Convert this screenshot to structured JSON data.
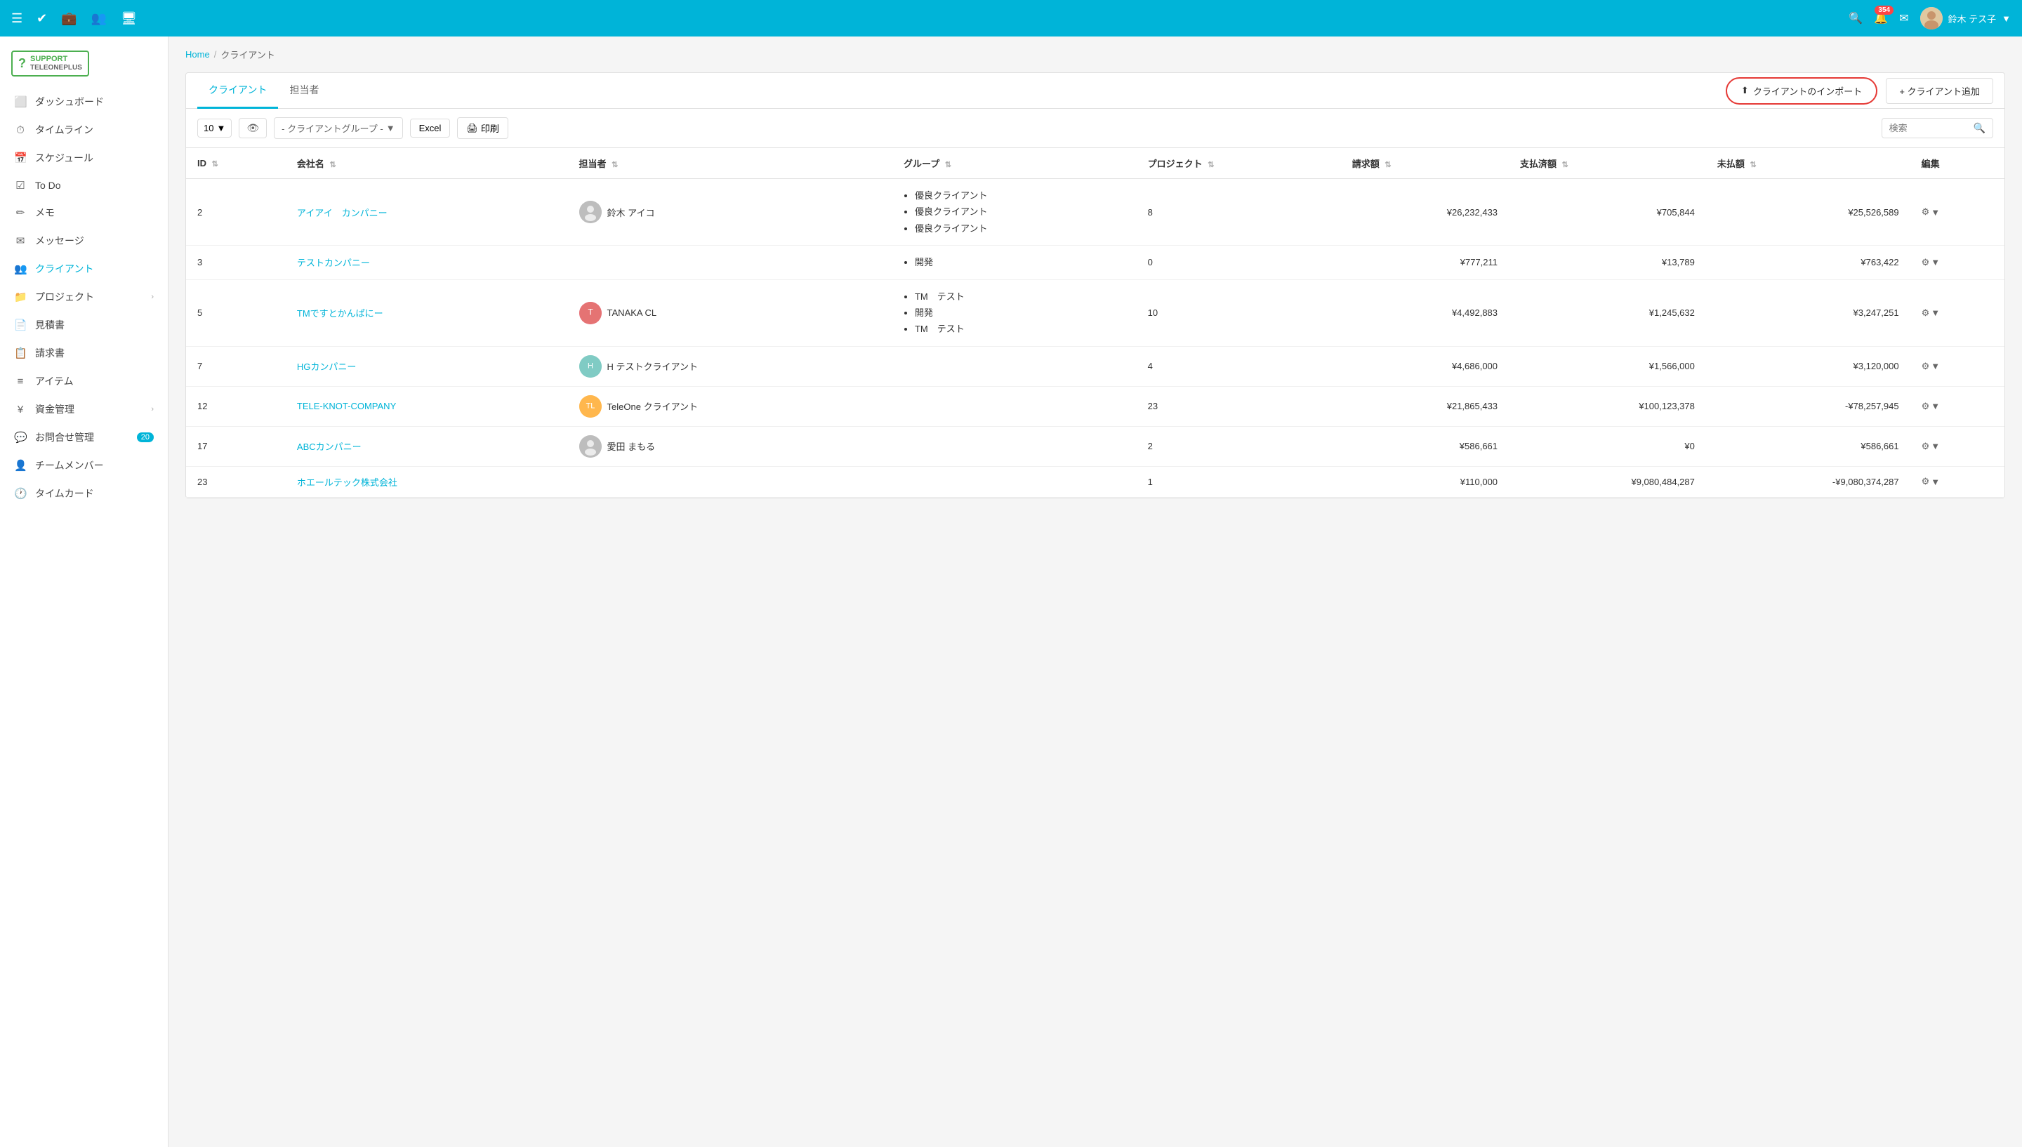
{
  "logo": {
    "icon": "?",
    "line1": "SUPPORT",
    "line2": "TELEONEPLUS"
  },
  "topnav": {
    "notification_count": "354",
    "username": "鈴木 テス子"
  },
  "sidebar": {
    "items": [
      {
        "id": "dashboard",
        "label": "ダッシュボード",
        "icon": "🖥",
        "has_arrow": false,
        "badge": null
      },
      {
        "id": "timeline",
        "label": "タイムライン",
        "icon": "⏱",
        "has_arrow": false,
        "badge": null
      },
      {
        "id": "schedule",
        "label": "スケジュール",
        "icon": "📅",
        "has_arrow": false,
        "badge": null
      },
      {
        "id": "todo",
        "label": "To Do",
        "icon": "✅",
        "has_arrow": false,
        "badge": null
      },
      {
        "id": "memo",
        "label": "メモ",
        "icon": "✏",
        "has_arrow": false,
        "badge": null
      },
      {
        "id": "message",
        "label": "メッセージ",
        "icon": "✉",
        "has_arrow": false,
        "badge": null
      },
      {
        "id": "client",
        "label": "クライアント",
        "icon": "👥",
        "has_arrow": false,
        "badge": null,
        "active": true
      },
      {
        "id": "project",
        "label": "プロジェクト",
        "icon": "📁",
        "has_arrow": true,
        "badge": null
      },
      {
        "id": "estimate",
        "label": "見積書",
        "icon": "📄",
        "has_arrow": false,
        "badge": null
      },
      {
        "id": "invoice",
        "label": "請求書",
        "icon": "📋",
        "has_arrow": false,
        "badge": null
      },
      {
        "id": "items",
        "label": "アイテム",
        "icon": "≡",
        "has_arrow": false,
        "badge": null
      },
      {
        "id": "finance",
        "label": "資金管理",
        "icon": "¥",
        "has_arrow": true,
        "badge": null
      },
      {
        "id": "inquiry",
        "label": "お問合せ管理",
        "icon": "💬",
        "has_arrow": false,
        "badge": "20"
      },
      {
        "id": "team",
        "label": "チームメンバー",
        "icon": "👤",
        "has_arrow": false,
        "badge": null
      },
      {
        "id": "timecard",
        "label": "タイムカード",
        "icon": "🕐",
        "has_arrow": false,
        "badge": null
      }
    ]
  },
  "breadcrumb": {
    "home_label": "Home",
    "separator": "/",
    "current": "クライアント"
  },
  "tabs": [
    {
      "id": "client",
      "label": "クライアント",
      "active": true
    },
    {
      "id": "manager",
      "label": "担当者",
      "active": false
    }
  ],
  "actions": {
    "import_label": "クライアントのインポート",
    "add_label": "+ クライアント追加"
  },
  "controls": {
    "per_page": "10",
    "group_placeholder": "- クライアントグループ -",
    "excel_label": "Excel",
    "print_label": "印刷",
    "search_placeholder": "検索"
  },
  "table": {
    "columns": [
      {
        "key": "id",
        "label": "ID"
      },
      {
        "key": "company",
        "label": "会社名"
      },
      {
        "key": "manager",
        "label": "担当者"
      },
      {
        "key": "group",
        "label": "グループ"
      },
      {
        "key": "project",
        "label": "プロジェクト"
      },
      {
        "key": "invoice",
        "label": "請求額"
      },
      {
        "key": "paid",
        "label": "支払済額"
      },
      {
        "key": "unpaid",
        "label": "未払額"
      },
      {
        "key": "edit",
        "label": "編集"
      }
    ],
    "rows": [
      {
        "id": "2",
        "company": "アイアイ　カンパニー",
        "manager_name": "鈴木 アイコ",
        "manager_avatar": "gray",
        "groups": [
          "優良クライアント",
          "優良クライアント",
          "優良クライアント"
        ],
        "projects": "8",
        "invoice": "¥26,232,433",
        "paid": "¥705,844",
        "unpaid": "¥25,526,589",
        "unpaid_negative": false
      },
      {
        "id": "3",
        "company": "テストカンパニー",
        "manager_name": "",
        "manager_avatar": "",
        "groups": [
          "開発"
        ],
        "projects": "0",
        "invoice": "¥777,211",
        "paid": "¥13,789",
        "unpaid": "¥763,422",
        "unpaid_negative": false
      },
      {
        "id": "5",
        "company": "TMですとかんぱにー",
        "manager_name": "TANAKA CL",
        "manager_avatar": "tanaka",
        "groups": [
          "TM　テスト",
          "開発",
          "TM　テスト"
        ],
        "projects": "10",
        "invoice": "¥4,492,883",
        "paid": "¥1,245,632",
        "unpaid": "¥3,247,251",
        "unpaid_negative": false
      },
      {
        "id": "7",
        "company": "HGカンパニー",
        "manager_name": "H テストクライアント",
        "manager_avatar": "hg",
        "groups": [],
        "projects": "4",
        "invoice": "¥4,686,000",
        "paid": "¥1,566,000",
        "unpaid": "¥3,120,000",
        "unpaid_negative": false
      },
      {
        "id": "12",
        "company": "TELE-KNOT-COMPANY",
        "manager_name": "TeleOne クライアント",
        "manager_avatar": "tele",
        "groups": [],
        "projects": "23",
        "invoice": "¥21,865,433",
        "paid": "¥100,123,378",
        "unpaid": "-¥78,257,945",
        "unpaid_negative": true
      },
      {
        "id": "17",
        "company": "ABCカンパニー",
        "manager_name": "愛田 まもる",
        "manager_avatar": "gray",
        "groups": [],
        "projects": "2",
        "invoice": "¥586,661",
        "paid": "¥0",
        "unpaid": "¥586,661",
        "unpaid_negative": false
      },
      {
        "id": "23",
        "company": "ホエールテック株式会社",
        "manager_name": "",
        "manager_avatar": "",
        "groups": [],
        "projects": "1",
        "invoice": "¥110,000",
        "paid": "¥9,080,484,287",
        "unpaid": "-¥9,080,374,287",
        "unpaid_negative": true
      }
    ]
  }
}
